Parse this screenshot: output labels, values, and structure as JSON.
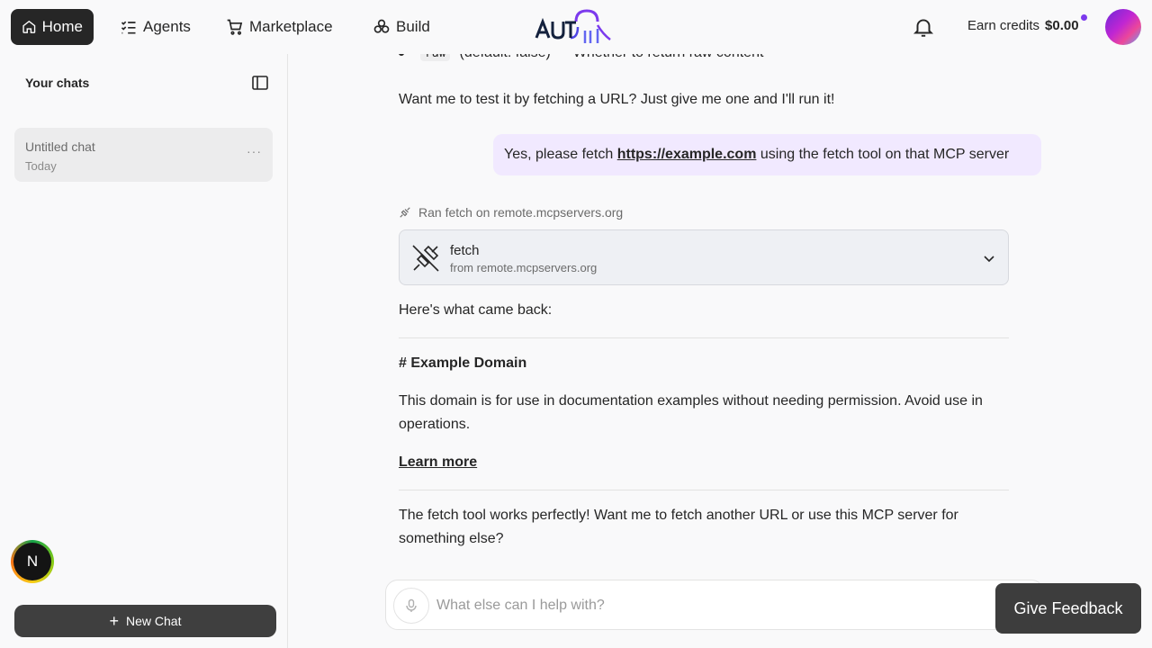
{
  "nav": {
    "home": "Home",
    "agents": "Agents",
    "marketplace": "Marketplace",
    "build": "Build"
  },
  "header": {
    "earn_credits": "Earn credits",
    "credits_amount": "$0.00"
  },
  "sidebar": {
    "title": "Your chats",
    "chats": [
      {
        "title": "Untitled chat",
        "date": "Today",
        "menu": "···"
      }
    ],
    "new_chat": "New Chat",
    "badge_letter": "N"
  },
  "conversation": {
    "bullet_code": "raw",
    "bullet_text": "(default: false) — Whether to return raw content",
    "assistant_prompt": "Want me to test it by fetching a URL? Just give me one and I'll run it!",
    "user_message_prefix": "Yes, please fetch ",
    "user_message_link": "https://example.com",
    "user_message_suffix": " using the fetch tool on that MCP server",
    "ran_label": "Ran fetch on remote.mcpservers.org",
    "tool": {
      "name": "fetch",
      "from": "from remote.mcpservers.org"
    },
    "result_intro": "Here's what came back:",
    "result_heading": "# Example Domain",
    "result_body": "This domain is for use in documentation examples without needing permission. Avoid use in operations.",
    "result_link": "Learn more",
    "closing": "The fetch tool works perfectly! Want me to fetch another URL or use this MCP server for something else?"
  },
  "input": {
    "placeholder": "What else can I help with?"
  },
  "feedback": "Give Feedback",
  "colors": {
    "accent": "#7c3aed",
    "user_bubble": "#f1e9ff",
    "dark_button": "#3f3f3f"
  }
}
